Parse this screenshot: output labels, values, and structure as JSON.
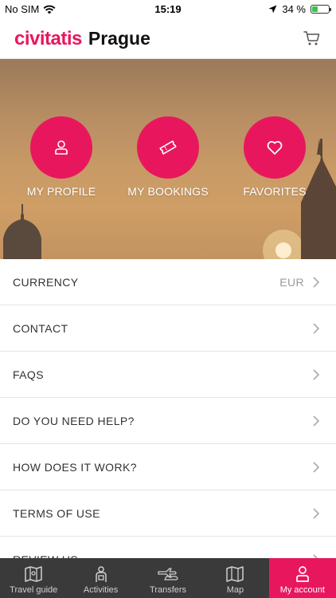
{
  "status_bar": {
    "carrier": "No SIM",
    "time": "15:19",
    "battery": "34 %",
    "battery_level": 0.34
  },
  "header": {
    "brand": "civitatis",
    "city": "Prague",
    "cart_icon": "cart-icon"
  },
  "hero": {
    "actions": [
      {
        "label": "MY PROFILE",
        "icon": "user-icon"
      },
      {
        "label": "MY BOOKINGS",
        "icon": "ticket-icon"
      },
      {
        "label": "FAVORITES",
        "icon": "heart-icon"
      }
    ]
  },
  "menu": {
    "items": [
      {
        "label": "CURRENCY",
        "value": "EUR"
      },
      {
        "label": "CONTACT"
      },
      {
        "label": "FAQS"
      },
      {
        "label": "DO YOU NEED HELP?"
      },
      {
        "label": "HOW DOES IT WORK?"
      },
      {
        "label": "TERMS OF USE"
      },
      {
        "label": "REVIEW US"
      }
    ]
  },
  "tabbar": {
    "tabs": [
      {
        "label": "Travel guide",
        "icon": "map-book-icon"
      },
      {
        "label": "Activities",
        "icon": "tour-guide-icon"
      },
      {
        "label": "Transfers",
        "icon": "plane-car-icon"
      },
      {
        "label": "Map",
        "icon": "map-icon"
      },
      {
        "label": "My account",
        "icon": "user-icon",
        "active": true
      }
    ]
  },
  "colors": {
    "accent": "#e8175d",
    "tabbar_bg": "#3a3a3a"
  }
}
